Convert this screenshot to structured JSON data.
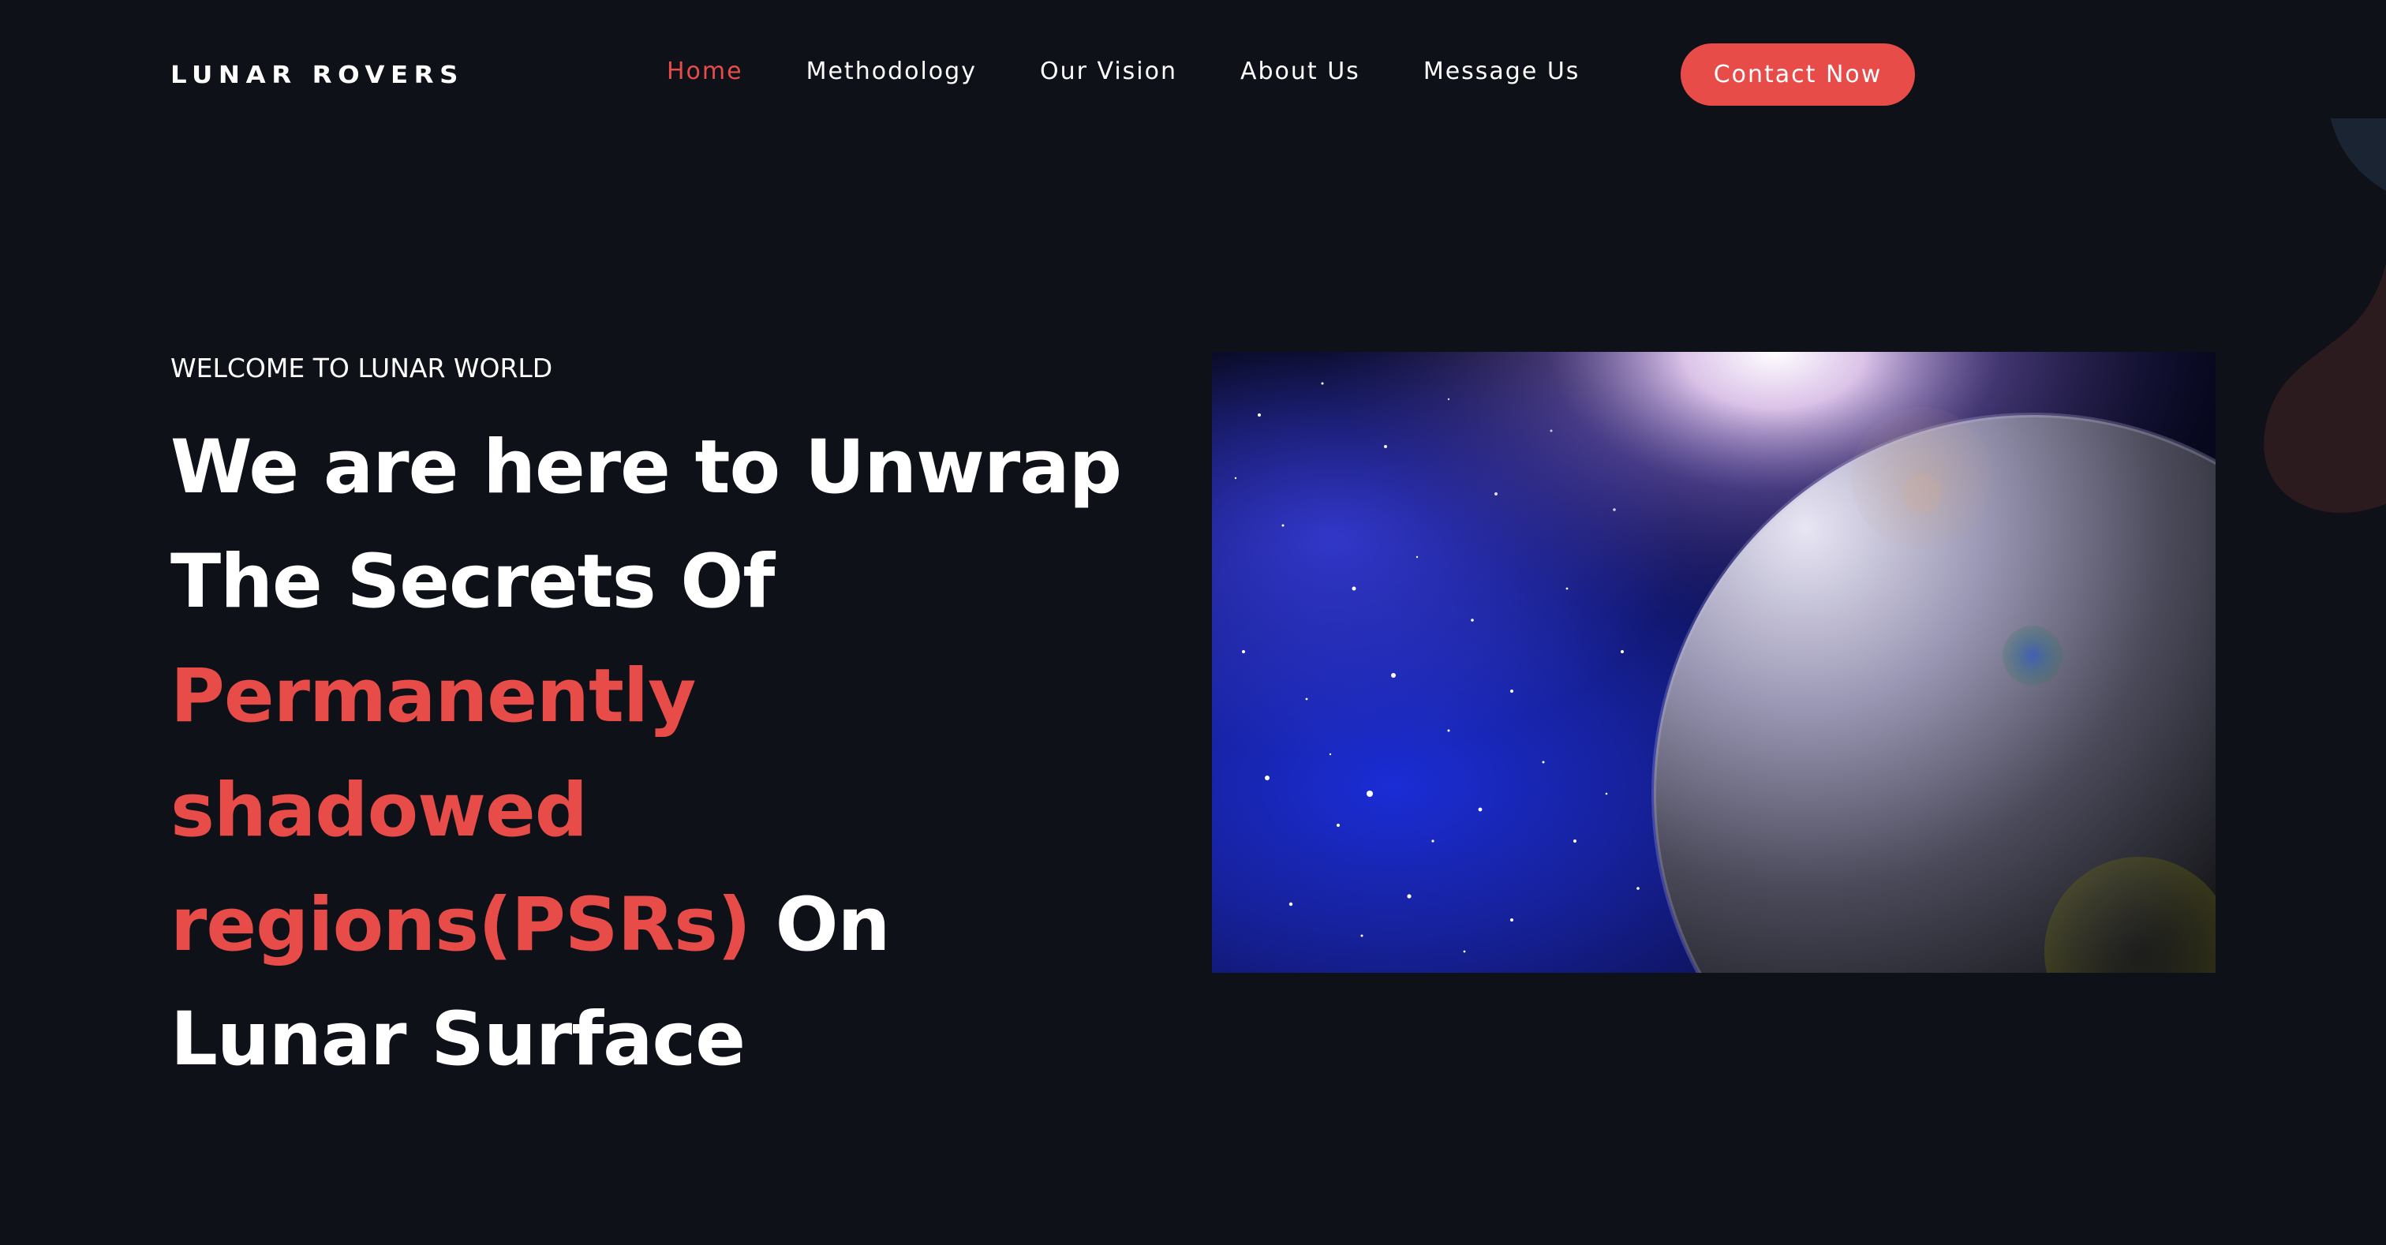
{
  "brand": {
    "logo": "LUNAR ROVERS"
  },
  "nav": {
    "items": [
      {
        "label": "Home",
        "active": true
      },
      {
        "label": "Methodology",
        "active": false
      },
      {
        "label": "Our Vision",
        "active": false
      },
      {
        "label": "About Us",
        "active": false
      },
      {
        "label": "Message Us",
        "active": false
      }
    ],
    "cta_label": "Contact Now"
  },
  "hero": {
    "eyebrow": "WELCOME TO LUNAR WORLD",
    "headline_line1": "We are here to Unwrap",
    "headline_line2": "The Secrets Of",
    "headline_accent_line1": "Permanently",
    "headline_accent_line2": "shadowed",
    "headline_accent_line3": "regions(PSRs)",
    "headline_after_accent": " On",
    "headline_last_line": "Lunar Surface",
    "image_icon": "planet-space-image"
  },
  "colors": {
    "background": "#0f1118",
    "accent": "#e74c49",
    "text": "#ffffff"
  }
}
